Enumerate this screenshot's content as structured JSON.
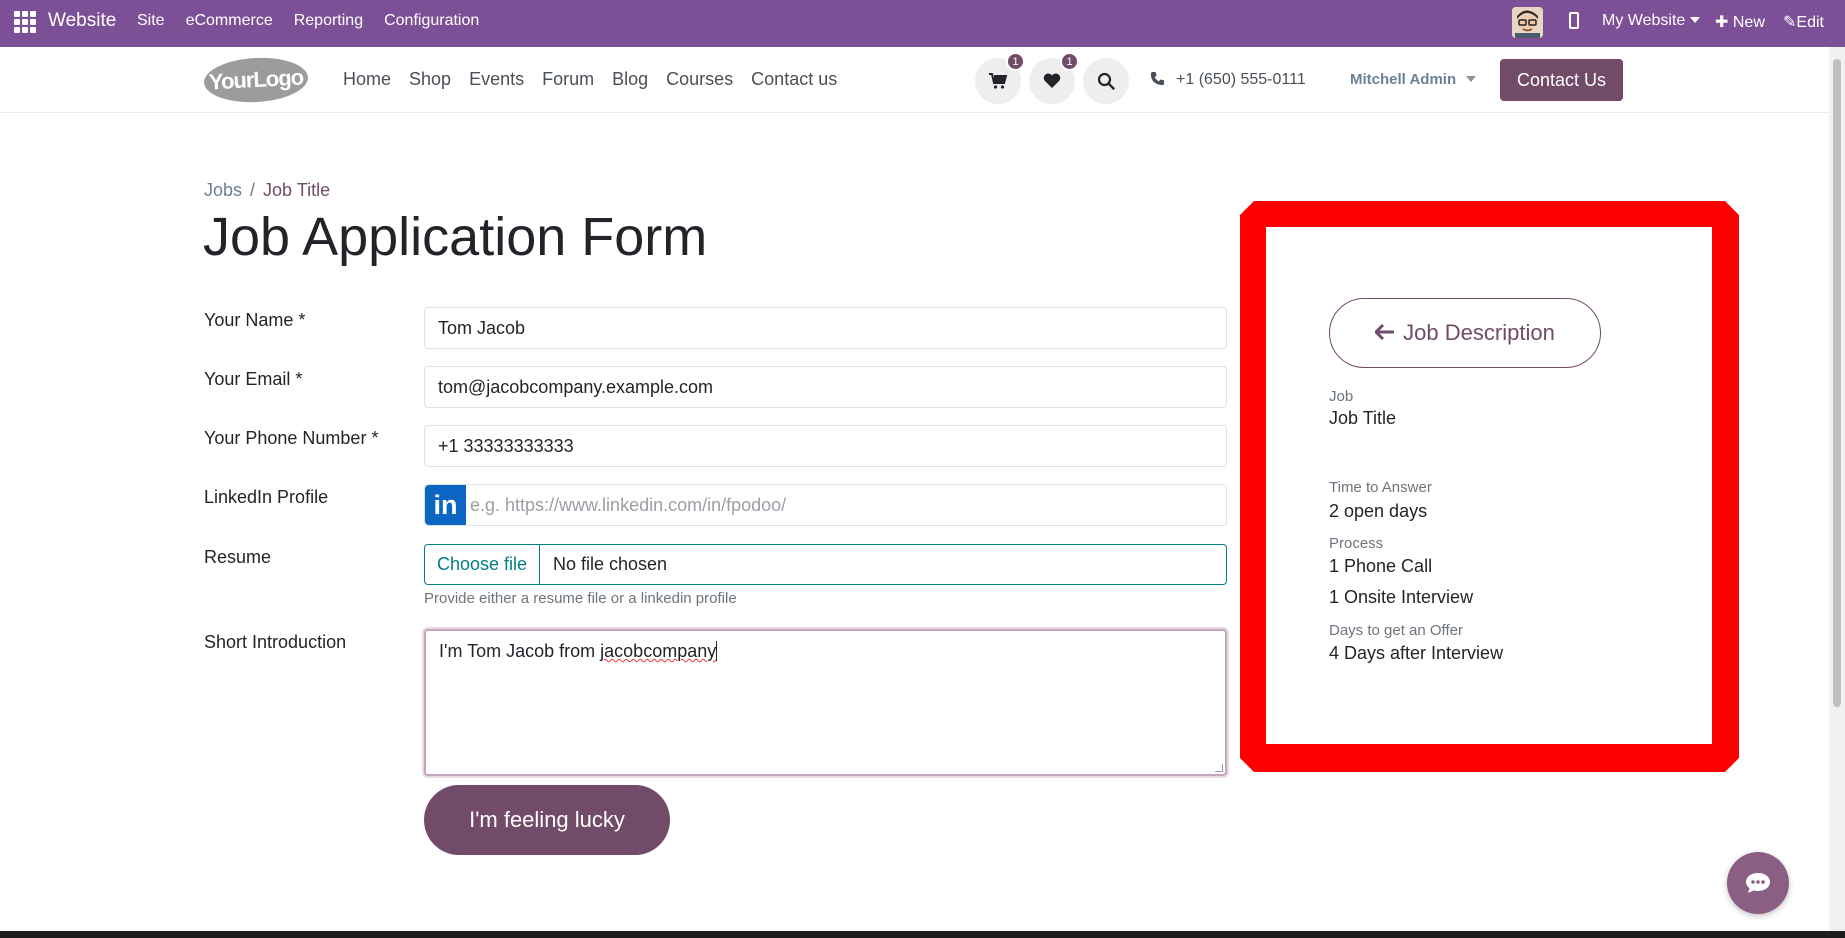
{
  "admin_bar": {
    "app_title": "Website",
    "menu": [
      "Site",
      "eCommerce",
      "Reporting",
      "Configuration"
    ],
    "website_selector": "My Website",
    "new_label": "New",
    "edit_label": "Edit"
  },
  "site_header": {
    "logo_text": "YourLogo",
    "nav": [
      "Home",
      "Shop",
      "Events",
      "Forum",
      "Blog",
      "Courses",
      "Contact us"
    ],
    "cart_count": "1",
    "wishlist_count": "1",
    "phone": "+1 (650) 555-0111",
    "user": "Mitchell Admin",
    "contact_button": "Contact Us"
  },
  "breadcrumb": {
    "parent": "Jobs",
    "separator": "/",
    "current": "Job Title"
  },
  "page_title": "Job Application Form",
  "form": {
    "name_label": "Your Name *",
    "name_value": "Tom Jacob",
    "email_label": "Your Email *",
    "email_value": "tom@jacobcompany.example.com",
    "phone_label": "Your Phone Number *",
    "phone_value": "+1 33333333333",
    "linkedin_label": "LinkedIn Profile",
    "linkedin_icon_text": "in",
    "linkedin_placeholder": "e.g. https://www.linkedin.com/in/fpodoo/",
    "resume_label": "Resume",
    "choose_file": "Choose file",
    "no_file": "No file chosen",
    "help_text": "Provide either a resume file or a linkedin profile",
    "intro_label": "Short Introduction",
    "intro_value_prefix": "I'm Tom Jacob from ",
    "intro_value_typo": "jacobcompany",
    "submit_label": "I'm feeling lucky"
  },
  "job_panel": {
    "back_button": "Job Description",
    "job_label": "Job",
    "job_value": "Job Title",
    "time_label": "Time to Answer",
    "time_value": "2 open days",
    "process_label": "Process",
    "process_steps": [
      "1 Phone Call",
      "1 Onsite Interview"
    ],
    "offer_label": "Days to get an Offer",
    "offer_value": "4 Days after Interview"
  },
  "colors": {
    "admin_bar": "#7c5097",
    "primary": "#714b67",
    "highlight_frame": "#ff0000",
    "file_accent": "#017e84",
    "linkedin": "#0a66c2"
  },
  "icons": [
    "apps-grid-icon",
    "avatar",
    "mobile-icon",
    "plus-icon",
    "pencil-icon",
    "cart-icon",
    "heart-icon",
    "search-icon",
    "phone-icon",
    "arrow-left-icon",
    "chat-icon"
  ]
}
